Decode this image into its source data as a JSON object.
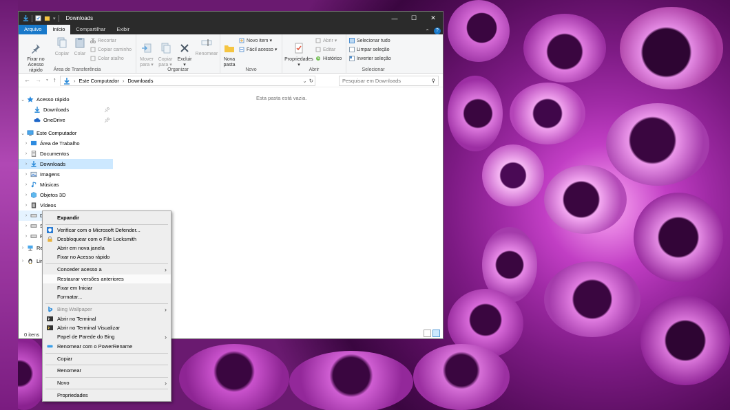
{
  "window": {
    "title": "Downloads",
    "controls": [
      "—",
      "☐",
      "✕"
    ]
  },
  "ribbon": {
    "tabs": [
      "Arquivo",
      "Início",
      "Compartilhar",
      "Exibir"
    ],
    "groups": {
      "clipboard": {
        "label": "Área de Transferência",
        "pin": "Fixar no\nAcesso rápido",
        "copy": "Copiar",
        "paste": "Colar",
        "cut": "Recortar",
        "copy_path": "Copiar caminho",
        "paste_shortcut": "Colar atalho"
      },
      "organize": {
        "label": "Organizar",
        "move": "Mover\npara ▾",
        "copy_to": "Copiar\npara ▾",
        "delete": "Excluir\n▾",
        "rename": "Renomear"
      },
      "new": {
        "label": "Novo",
        "new_folder": "Nova\npasta",
        "new_item": "Novo item ▾",
        "easy_access": "Fácil acesso ▾"
      },
      "open": {
        "label": "Abrir",
        "properties": "Propriedades\n▾",
        "open": "Abrir ▾",
        "edit": "Editar",
        "history": "Histórico"
      },
      "select": {
        "label": "Selecionar",
        "select_all": "Selecionar tudo",
        "select_none": "Limpar seleção",
        "invert": "Inverter seleção"
      }
    }
  },
  "address": {
    "crumb1": "Este Computador",
    "crumb2": "Downloads",
    "search_placeholder": "Pesquisar em Downloads"
  },
  "navpane": {
    "items": [
      {
        "label": "Acesso rápido"
      },
      {
        "label": "Downloads"
      },
      {
        "label": "OneDrive"
      },
      {
        "label": "Este Computador"
      },
      {
        "label": "Área de Trabalho"
      },
      {
        "label": "Documentos"
      },
      {
        "label": "Downloads"
      },
      {
        "label": "Imagens"
      },
      {
        "label": "Músicas"
      },
      {
        "label": "Objetos 3D"
      },
      {
        "label": "Vídeos"
      },
      {
        "label": "D"
      },
      {
        "label": "S"
      },
      {
        "label": "F"
      },
      {
        "label": "Re"
      },
      {
        "label": "Lir"
      }
    ]
  },
  "content": {
    "empty_text": "Esta pasta está vazia."
  },
  "status": {
    "count": "0 itens"
  },
  "context_menu": {
    "items": [
      {
        "label": "Expandir"
      },
      {
        "label": "Verificar com o Microsoft Defender..."
      },
      {
        "label": "Desbloquear com o File Locksmith"
      },
      {
        "label": "Abrir em nova janela"
      },
      {
        "label": "Fixar no Acesso rápido"
      },
      {
        "label": "Conceder acesso a"
      },
      {
        "label": "Restaurar versões anteriores"
      },
      {
        "label": "Fixar em Iniciar"
      },
      {
        "label": "Formatar..."
      },
      {
        "label": "Bing Wallpaper"
      },
      {
        "label": "Abrir no Terminal"
      },
      {
        "label": "Abrir no Terminal Visualizar"
      },
      {
        "label": "Papel de Parede do Bing"
      },
      {
        "label": "Renomear com o PowerRename"
      },
      {
        "label": "Copiar"
      },
      {
        "label": "Renomear"
      },
      {
        "label": "Novo"
      },
      {
        "label": "Propriedades"
      }
    ]
  },
  "colors": {
    "accent": "#1979ca",
    "selection": "#cce8ff",
    "titlebar": "#2b2b2b"
  }
}
